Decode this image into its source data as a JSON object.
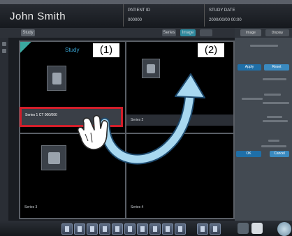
{
  "header": {
    "patient_name": "John Smith",
    "field1_label": "PATIENT ID",
    "field1_value": "000000",
    "field2_label": "STUDY DATE",
    "field2_value": "2000/00/00 00:00"
  },
  "tabs": {
    "items": [
      "Study",
      "Series",
      "Image"
    ]
  },
  "viewer": {
    "cell1_number": "(1)",
    "cell2_number": "(2)",
    "cell1_tag": "Study",
    "selected_series_label": "Series 1 CT 000/000",
    "cell2_series_label": "Series 2",
    "cell3_series_label": "Series 3",
    "cell4_series_label": "Series 4"
  },
  "right_panel": {
    "tabs": [
      "Image",
      "Display"
    ],
    "button1": "Apply",
    "button2": "Reset",
    "button3": "OK",
    "button4": "Cancel"
  },
  "colors": {
    "highlight": "#d21e2a",
    "arrow": "#a8d8f0",
    "accent": "#1f6fa8"
  },
  "icons": {
    "hand": "hand-pointer-icon",
    "arrow": "curved-arrow-icon"
  }
}
